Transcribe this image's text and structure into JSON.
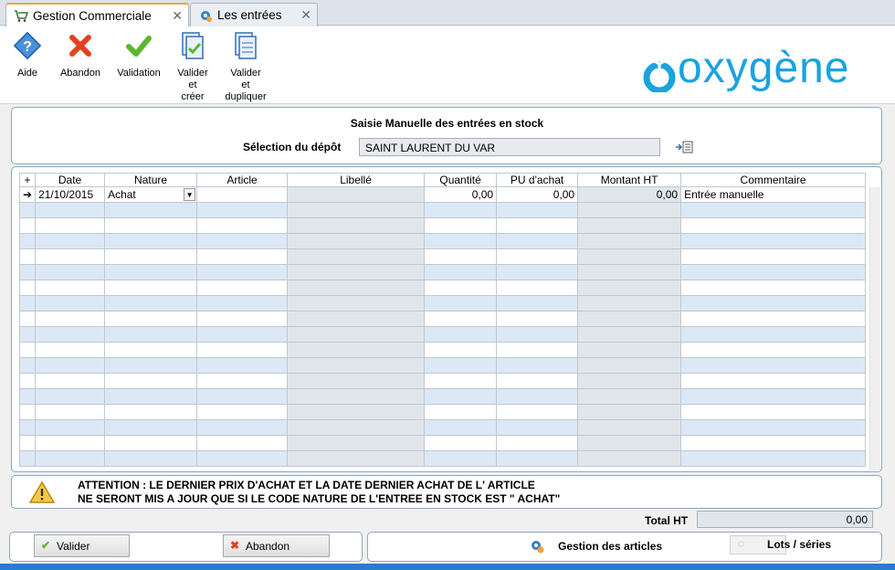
{
  "tabs": [
    {
      "label": "Gestion Commerciale",
      "icon": "cart-icon"
    },
    {
      "label": "Les entrées",
      "icon": "gear-icon"
    }
  ],
  "toolbar": {
    "aide": "Aide",
    "abandon": "Abandon",
    "validation": "Validation",
    "valider_creer": [
      "Valider",
      "et",
      "créer"
    ],
    "valider_dupliquer": [
      "Valider",
      "et",
      "dupliquer"
    ]
  },
  "logo": "oxygène",
  "form": {
    "title": "Saisie Manuelle des entrées en stock",
    "depot_label": "Sélection du dépôt",
    "depot_value": "SAINT LAURENT DU VAR"
  },
  "grid": {
    "columns": [
      "Date",
      "Nature",
      "Article",
      "Libellé",
      "Quantité",
      "PU d'achat",
      "Montant HT",
      "Commentaire"
    ],
    "row1": {
      "date": "21/10/2015",
      "nature": "Achat",
      "article": "",
      "libelle": "",
      "quantite": "0,00",
      "pu_achat": "0,00",
      "montant_ht": "0,00",
      "commentaire": "Entrée manuelle"
    }
  },
  "warning": {
    "line1": "ATTENTION : LE DERNIER PRIX D'ACHAT ET LA DATE DERNIER ACHAT DE L' ARTICLE",
    "line2": "NE SERONT MIS A JOUR QUE SI LE CODE NATURE DE L'ENTREE EN STOCK EST \" ACHAT\""
  },
  "totals": {
    "label": "Total HT",
    "value": "0,00"
  },
  "buttons": {
    "valider": "Valider",
    "abandon": "Abandon",
    "gestion_articles": "Gestion des articles",
    "lots_series": "Lots / séries"
  },
  "colors": {
    "accent": "#1aa3de",
    "row_alt": "#dde8f6",
    "tab_active_top": "#f3a33b"
  }
}
